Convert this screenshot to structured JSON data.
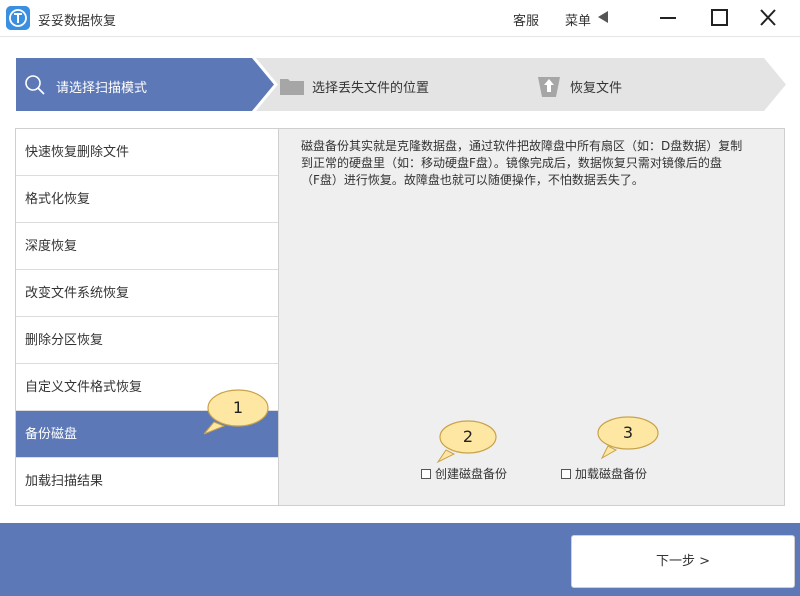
{
  "window": {
    "title": "妥妥数据恢复",
    "service_label": "客服",
    "menu_label": "菜单"
  },
  "steps": [
    {
      "label": "请选择扫描模式",
      "active": true,
      "icon": "search-icon"
    },
    {
      "label": "选择丢失文件的位置",
      "active": false,
      "icon": "folder-icon"
    },
    {
      "label": "恢复文件",
      "active": false,
      "icon": "upload-icon"
    }
  ],
  "sidebar": {
    "items": [
      {
        "label": "快速恢复删除文件"
      },
      {
        "label": "格式化恢复"
      },
      {
        "label": "深度恢复"
      },
      {
        "label": "改变文件系统恢复"
      },
      {
        "label": "删除分区恢复"
      },
      {
        "label": "自定义文件格式恢复"
      },
      {
        "label": "备份磁盘",
        "active": true
      },
      {
        "label": "加载扫描结果"
      }
    ]
  },
  "content": {
    "description_line1": "磁盘备份其实就是克隆数据盘，通过软件把故障盘中所有扇区（如：D盘数据）复制",
    "description_line2": "到正常的硬盘里（如：移动硬盘F盘）。镜像完成后，数据恢复只需对镜像后的盘",
    "description_line3": "（F盘）进行恢复。故障盘也就可以随便操作，不怕数据丢失了。",
    "options": [
      {
        "label": "创建磁盘备份",
        "checked": false
      },
      {
        "label": "加载磁盘备份",
        "checked": false
      }
    ]
  },
  "callouts": [
    "1",
    "2",
    "3"
  ],
  "footer": {
    "next_label": "下一步 >"
  },
  "colors": {
    "accent": "#5c78b6",
    "step_inactive": "#e4e4e4",
    "content_bg": "#efefef",
    "callout_fill": "#fde7a2"
  }
}
